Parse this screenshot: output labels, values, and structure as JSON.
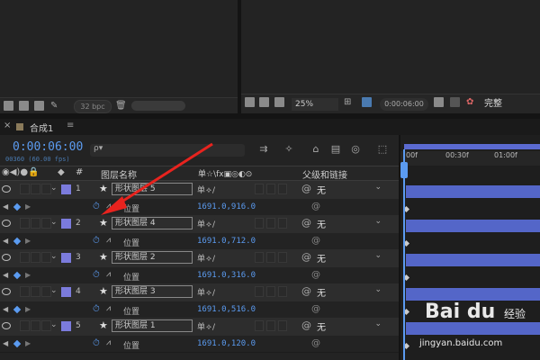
{
  "toolbar": {
    "bpc": "32 bpc"
  },
  "viewer": {
    "zoom": "25%",
    "timecode": "0:00:06:00",
    "quality": "完整"
  },
  "tab": {
    "close": "×",
    "name": "合成1",
    "menu": "≡"
  },
  "timeline": {
    "current_time": "0:00:06:00",
    "fps_readout": "00360 (60.00 fps)",
    "search_placeholder": "ρ▾",
    "columns": {
      "layer_name": "图层名称",
      "switches": "单☆\\fx▣◎◐⊙",
      "parent": "父级和链接",
      "num": "#"
    },
    "ruler_ticks": [
      "00f",
      "00:30f",
      "01:00f"
    ],
    "layers": [
      {
        "num": "1",
        "name": "形状图层 5",
        "parent": "无",
        "prop": "位置",
        "value": "1691.0,916.0"
      },
      {
        "num": "2",
        "name": "形状图层 4",
        "parent": "无",
        "prop": "位置",
        "value": "1691.0,712.0"
      },
      {
        "num": "3",
        "name": "形状图层 2",
        "parent": "无",
        "prop": "位置",
        "value": "1691.0,316.0"
      },
      {
        "num": "4",
        "name": "形状图层 3",
        "parent": "无",
        "prop": "位置",
        "value": "1691.0,516.0"
      },
      {
        "num": "5",
        "name": "形状图层 1",
        "parent": "无",
        "prop": "位置",
        "value": "1691.0,120.0"
      }
    ]
  },
  "watermark": {
    "logo": "Bai du",
    "brand": "经验",
    "url": "jingyan.baidu.com"
  },
  "colors": {
    "accent": "#5b9bf0",
    "layer_label": "#7b7bdc",
    "bar": "#5466c8",
    "arrow": "#e8231e"
  }
}
